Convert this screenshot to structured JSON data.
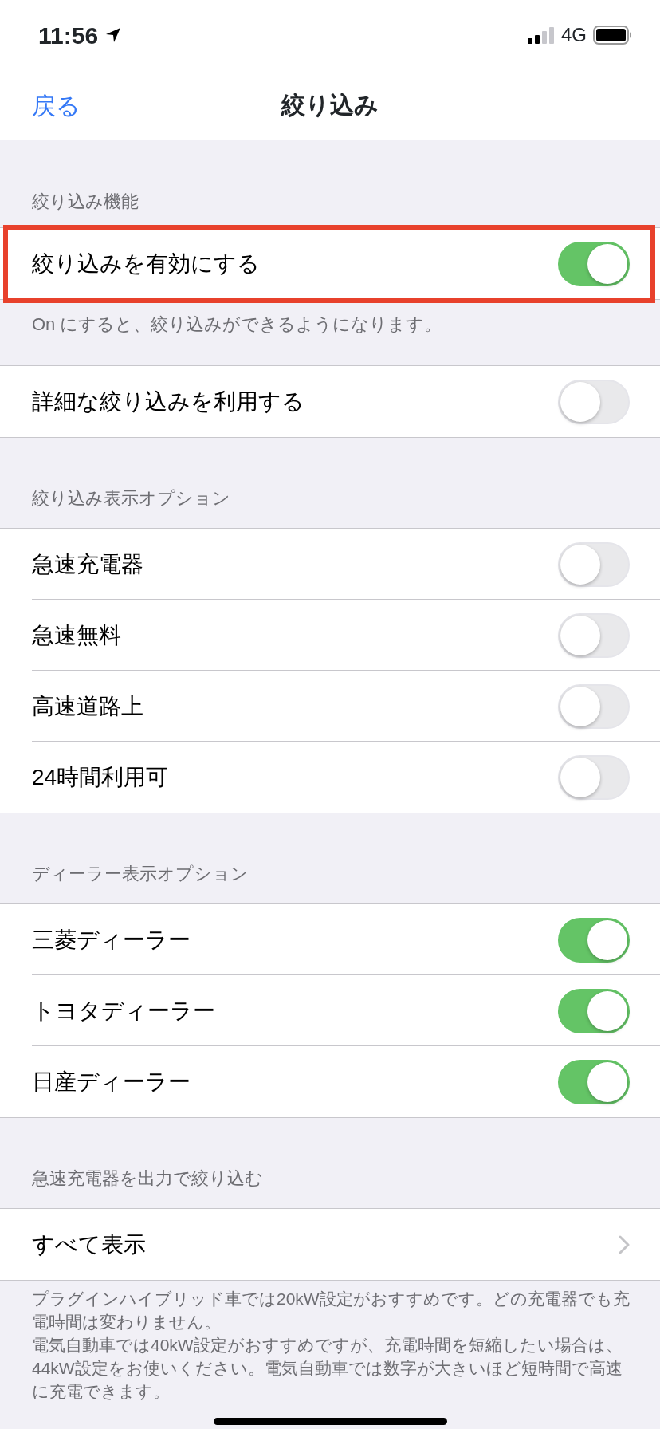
{
  "status_bar": {
    "time": "11:56",
    "network": "4G"
  },
  "nav": {
    "back": "戻る",
    "title": "絞り込み"
  },
  "sections": [
    {
      "header": "絞り込み機能",
      "rows": [
        {
          "kind": "toggle",
          "label": "絞り込みを有効にする",
          "on": true,
          "highlighted": true
        }
      ],
      "footer": "On にすると、絞り込みができるようになります。"
    },
    {
      "rows": [
        {
          "kind": "toggle",
          "label": "詳細な絞り込みを利用する",
          "on": false,
          "highlighted": false
        }
      ]
    },
    {
      "header": "絞り込み表示オプション",
      "rows": [
        {
          "kind": "toggle",
          "label": "急速充電器",
          "on": false,
          "highlighted": false
        },
        {
          "kind": "toggle",
          "label": "急速無料",
          "on": false,
          "highlighted": false
        },
        {
          "kind": "toggle",
          "label": "高速道路上",
          "on": false,
          "highlighted": false
        },
        {
          "kind": "toggle",
          "label": "24時間利用可",
          "on": false,
          "highlighted": false
        }
      ]
    },
    {
      "header": "ディーラー表示オプション",
      "rows": [
        {
          "kind": "toggle",
          "label": "三菱ディーラー",
          "on": true,
          "highlighted": false
        },
        {
          "kind": "toggle",
          "label": "トヨタディーラー",
          "on": true,
          "highlighted": false
        },
        {
          "kind": "toggle",
          "label": "日産ディーラー",
          "on": true,
          "highlighted": false
        }
      ]
    },
    {
      "header": "急速充電器を出力で絞り込む",
      "rows": [
        {
          "kind": "link",
          "label": "すべて表示",
          "highlighted": false
        }
      ],
      "footer_lines": [
        "プラグインハイブリッド車では20kW設定がおすすめです。どの充電器でも充電時間は変わりません。",
        "電気自動車では40kW設定がおすすめですが、充電時間を短縮したい場合は、44kW設定をお使いください。電気自動車では数字が大きいほど短時間で高速に充電できます。"
      ]
    }
  ]
}
